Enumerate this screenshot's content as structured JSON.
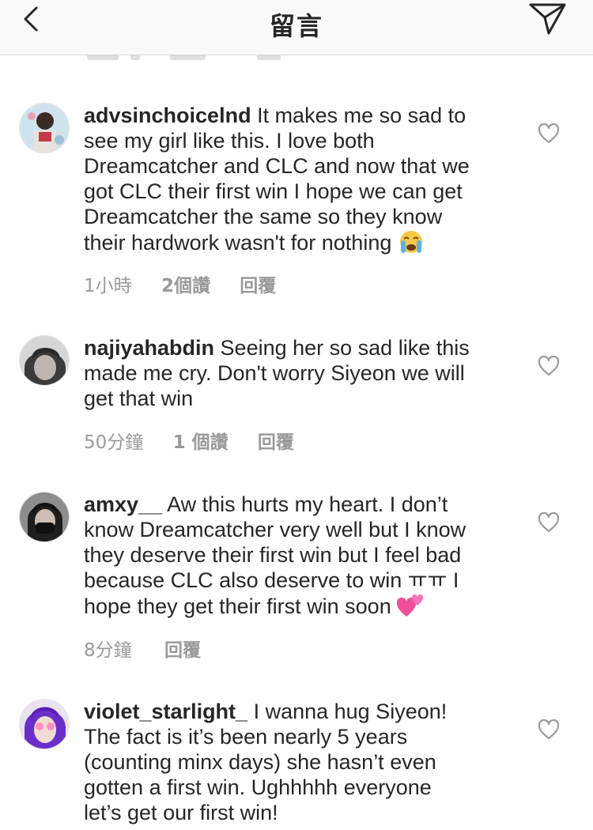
{
  "header": {
    "title": "留言",
    "back_icon": "chevron-left-icon",
    "send_icon": "paper-plane-icon"
  },
  "comments": [
    {
      "username": "advsinchoicelnd",
      "lines": [
        " It makes me so sad to",
        "see my girl like this. I love both",
        "Dreamcatcher and CLC and now that we",
        "got CLC their first win I hope we can get",
        "Dreamcatcher the same so they know",
        "their hardwork wasn't for nothing "
      ],
      "emoji": "crying-face-emoji",
      "time": "1小時",
      "likes": "2個讚",
      "reply": "回覆"
    },
    {
      "username": "najiyahabdin",
      "lines": [
        " Seeing her so sad like this",
        "made me cry. Don't worry Siyeon we will",
        "get that win"
      ],
      "time": "50分鐘",
      "likes": "1 個讚",
      "reply": "回覆"
    },
    {
      "username": "amxy__",
      "lines": [
        " Aw this hurts my heart. I don’t",
        "know Dreamcatcher very well but I know",
        "they deserve their first win but I feel bad",
        "because CLC also deserve to win ㅠㅠ I",
        "hope they get their first win soon "
      ],
      "emoji": "two-hearts-emoji",
      "time": "8分鐘",
      "reply": "回覆"
    },
    {
      "username": "violet_starlight_",
      "lines": [
        " I wanna hug Siyeon!",
        "The fact is it’s been nearly 5 years",
        "(counting minx days) she hasn’t even",
        "gotten a first win. Ughhhhh everyone",
        "let’s get our first win!"
      ]
    }
  ],
  "colors": {
    "text": "#262626",
    "meta": "#9a9a9a",
    "header_bg": "#fafafa",
    "divider": "#d8d8d8"
  }
}
